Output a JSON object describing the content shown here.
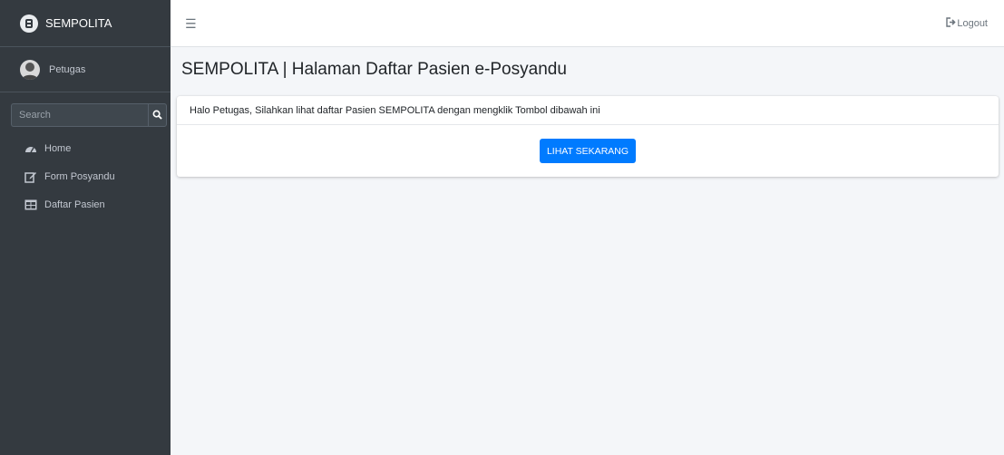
{
  "brand": {
    "name": "SEMPOLITA"
  },
  "user": {
    "name": "Petugas"
  },
  "search": {
    "placeholder": "Search"
  },
  "nav": {
    "items": [
      {
        "label": "Home",
        "icon": "tachometer-icon"
      },
      {
        "label": "Form Posyandu",
        "icon": "edit-icon"
      },
      {
        "label": "Daftar Pasien",
        "icon": "table-icon"
      }
    ]
  },
  "navbar": {
    "menu_icon": "hamburger-icon",
    "logout_label": "Logout"
  },
  "page": {
    "title": "SEMPOLITA | Halaman Daftar Pasien e-Posyandu"
  },
  "card": {
    "header_text": "Halo Petugas, Silahkan lihat daftar Pasien SEMPOLITA dengan mengklik Tombol dibawah ini",
    "button_label": "LIHAT SEKARANG"
  },
  "colors": {
    "sidebar_bg": "#343a40",
    "content_bg": "#f4f6f9",
    "primary": "#007bff"
  }
}
